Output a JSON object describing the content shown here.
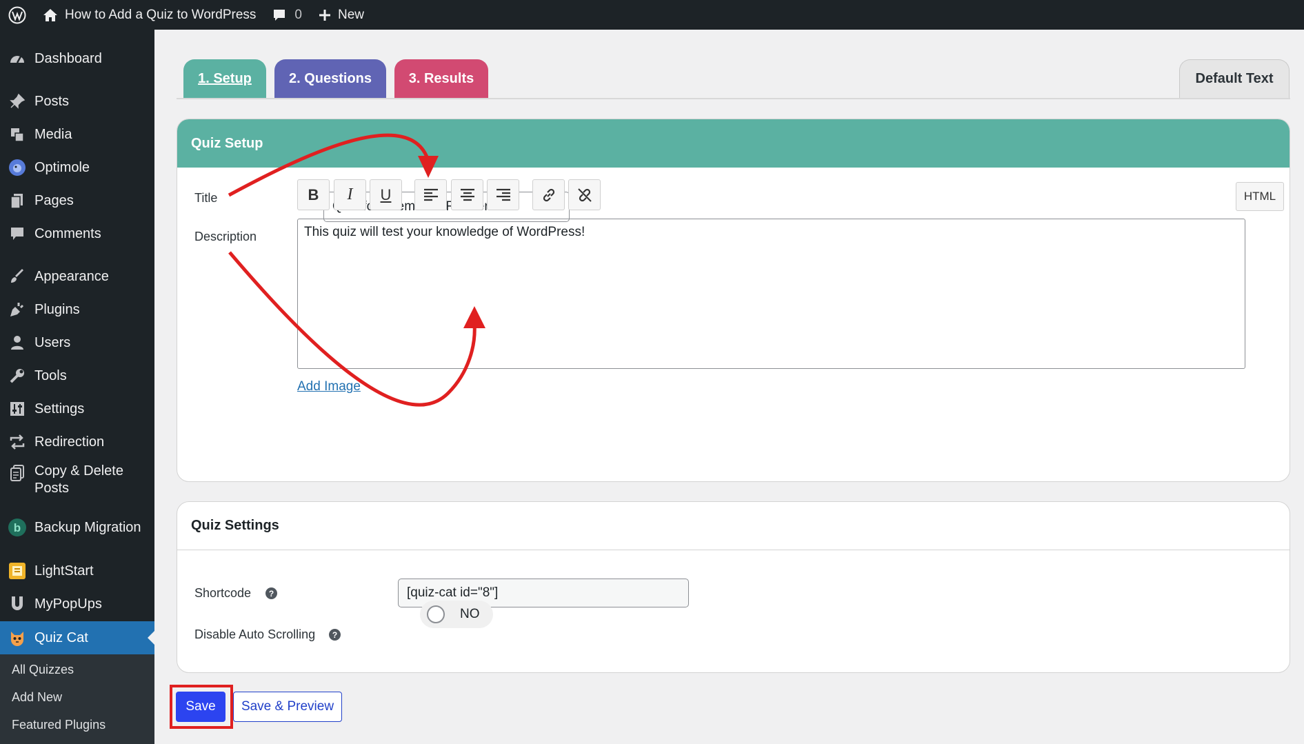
{
  "admin_bar": {
    "wp_logo_icon": "wordpress-logo-icon",
    "site_title": "How to Add a Quiz to WordPress",
    "comments_count": "0",
    "new_label": "New"
  },
  "sidebar": {
    "items": [
      {
        "label": "Dashboard",
        "icon": "dashboard-icon"
      },
      {
        "label": "Posts",
        "icon": "pin-icon"
      },
      {
        "label": "Media",
        "icon": "media-icon"
      },
      {
        "label": "Optimole",
        "icon": "optimole-icon"
      },
      {
        "label": "Pages",
        "icon": "pages-icon"
      },
      {
        "label": "Comments",
        "icon": "comment-icon"
      },
      {
        "label": "Appearance",
        "icon": "brush-icon"
      },
      {
        "label": "Plugins",
        "icon": "plug-icon"
      },
      {
        "label": "Users",
        "icon": "user-icon"
      },
      {
        "label": "Tools",
        "icon": "wrench-icon"
      },
      {
        "label": "Settings",
        "icon": "sliders-icon"
      },
      {
        "label": "Redirection",
        "icon": "redirect-icon"
      },
      {
        "label": "Copy & Delete",
        "label2": "Posts",
        "icon": "copy-icon"
      },
      {
        "label": "Backup Migration",
        "icon": "backup-icon"
      },
      {
        "label": "LightStart",
        "icon": "lightstart-icon"
      },
      {
        "label": "MyPopUps",
        "icon": "magnet-icon"
      },
      {
        "label": "Quiz Cat",
        "icon": "cat-icon"
      }
    ],
    "submenu": [
      "All Quizzes",
      "Add New",
      "Featured Plugins"
    ]
  },
  "tabs": {
    "setup": "1. Setup",
    "questions": "2. Questions",
    "results": "3. Results",
    "default_text": "Default Text"
  },
  "quiz_setup": {
    "header": "Quiz Setup",
    "title_label": "Title",
    "title_value": "Quiz for Themeisle Readers",
    "description_label": "Description",
    "toolbar": {
      "bold": "B",
      "italic": "I",
      "underline": "U",
      "html": "HTML"
    },
    "description_value": "This quiz will test your knowledge of WordPress!",
    "add_image": "Add Image"
  },
  "quiz_settings": {
    "header": "Quiz Settings",
    "shortcode_label": "Shortcode",
    "shortcode_value": "[quiz-cat id=\"8\"]",
    "auto_scroll_label": "Disable Auto Scrolling",
    "auto_scroll_value": "NO"
  },
  "actions": {
    "save": "Save",
    "save_preview": "Save & Preview"
  },
  "colors": {
    "setup_tab": "#5bb1a2",
    "questions_tab": "#6064b4",
    "results_tab": "#d24a72",
    "accent_blue": "#2271b1",
    "annotation_red": "#e02020"
  }
}
